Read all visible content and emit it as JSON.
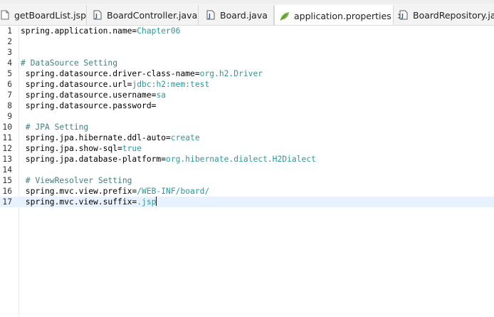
{
  "tabs": [
    {
      "label": "getBoardList.jsp",
      "icon": "jsp-file-icon",
      "active": false
    },
    {
      "label": "BoardController.java",
      "icon": "java-file-icon",
      "active": false
    },
    {
      "label": "Board.java",
      "icon": "java-file-icon",
      "active": false
    },
    {
      "label": "application.properties",
      "icon": "properties-file-icon",
      "active": true,
      "close": "✕"
    },
    {
      "label": "BoardRepository.java",
      "icon": "java-file-icon",
      "active": false
    }
  ],
  "lines": [
    {
      "num": "1",
      "key": "spring.application.name=",
      "value": "Chapter06"
    },
    {
      "num": "2"
    },
    {
      "num": "3"
    },
    {
      "num": "4",
      "comment": "# DataSource Setting"
    },
    {
      "num": "5",
      "key": " spring.datasource.driver-class-name=",
      "value": "org.h2.Driver"
    },
    {
      "num": "6",
      "key": " spring.datasource.url=",
      "value": "jdbc:h2:mem:test"
    },
    {
      "num": "7",
      "key": " spring.datasource.username=",
      "value": "sa"
    },
    {
      "num": "8",
      "key": " spring.datasource.password="
    },
    {
      "num": "9"
    },
    {
      "num": "10",
      "comment": " # JPA Setting"
    },
    {
      "num": "11",
      "key": " spring.jpa.hibernate.ddl-auto=",
      "value": "create"
    },
    {
      "num": "12",
      "key": " spring.jpa.show-sql=",
      "value": "true"
    },
    {
      "num": "13",
      "key": " spring.jpa.database-platform=",
      "value": "org.hibernate.dialect.H2Dialect"
    },
    {
      "num": "14"
    },
    {
      "num": "15",
      "comment": " # ViewResolver Setting"
    },
    {
      "num": "16",
      "key": " spring.mvc.view.prefix=",
      "value": "/WEB-INF/board/"
    },
    {
      "num": "17",
      "key": " spring.mvc.view.suffix=",
      "value": ".jsp",
      "current": true
    }
  ],
  "colors": {
    "value": "#2a9a9a",
    "comment": "#3f7f7f",
    "current_line": "#e8f2fe"
  }
}
